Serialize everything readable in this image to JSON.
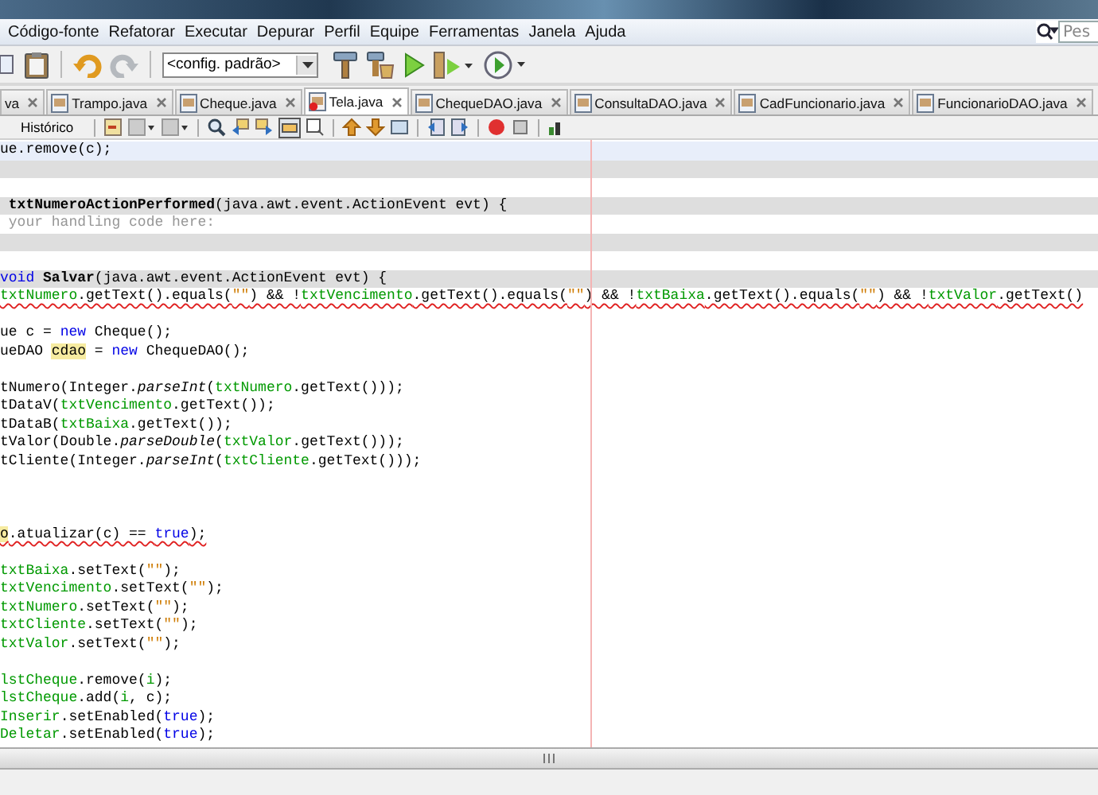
{
  "menu": [
    "Código-fonte",
    "Refatorar",
    "Executar",
    "Depurar",
    "Perfil",
    "Equipe",
    "Ferramentas",
    "Janela",
    "Ajuda"
  ],
  "toolbar": {
    "config": "<config. padrão>"
  },
  "search": {
    "placeholder": "Pes"
  },
  "tabs": [
    {
      "label": "va",
      "selected": false,
      "error": false
    },
    {
      "label": "Trampo.java",
      "selected": false,
      "error": false
    },
    {
      "label": "Cheque.java",
      "selected": false,
      "error": false
    },
    {
      "label": "Tela.java",
      "selected": true,
      "error": true
    },
    {
      "label": "ChequeDAO.java",
      "selected": false,
      "error": false
    },
    {
      "label": "ConsultaDAO.java",
      "selected": false,
      "error": false
    },
    {
      "label": "CadFuncionario.java",
      "selected": false,
      "error": false
    },
    {
      "label": "FuncionarioDAO.java",
      "selected": false,
      "error": false
    }
  ],
  "editor_toolbar": {
    "history": "Histórico"
  },
  "code": {
    "lines": [
      {
        "guarded": false,
        "current": true,
        "error": false,
        "segments": [
          {
            "kind": "plain",
            "text": "ue.remove(c);"
          }
        ]
      },
      {
        "guarded": true,
        "current": false,
        "error": false
      },
      {
        "guarded": false,
        "current": false,
        "error": false
      },
      {
        "guarded": true,
        "current": false,
        "error": false,
        "segments": [
          {
            "kind": "method",
            "text": " txtNumeroActionPerformed"
          },
          {
            "kind": "plain",
            "text": "(java.awt.event.ActionEvent evt) {"
          }
        ]
      },
      {
        "guarded": false,
        "current": false,
        "error": false,
        "segments": [
          {
            "kind": "comment",
            "text": " your handling code here:"
          }
        ]
      },
      {
        "guarded": true,
        "current": false,
        "error": false
      },
      {
        "guarded": false,
        "current": false,
        "error": false
      },
      {
        "guarded": true,
        "current": false,
        "error": false,
        "segments": [
          {
            "kind": "keyword",
            "text": "void "
          },
          {
            "kind": "method",
            "text": "Salvar"
          },
          {
            "kind": "plain",
            "text": "(java.awt.event.ActionEvent evt) {"
          }
        ]
      },
      {
        "guarded": false,
        "current": false,
        "error": true,
        "segments": [
          {
            "kind": "field",
            "text": "txtNumero"
          },
          {
            "kind": "plain",
            "text": ".getText().equals("
          },
          {
            "kind": "string",
            "text": "\"\""
          },
          {
            "kind": "plain",
            "text": ") && !"
          },
          {
            "kind": "field",
            "text": "txtVencimento"
          },
          {
            "kind": "plain",
            "text": ".getText().equals("
          },
          {
            "kind": "string",
            "text": "\"\""
          },
          {
            "kind": "plain",
            "text": ") && !"
          },
          {
            "kind": "field",
            "text": "txtBaixa"
          },
          {
            "kind": "plain",
            "text": ".getText().equals("
          },
          {
            "kind": "string",
            "text": "\"\""
          },
          {
            "kind": "plain",
            "text": ") && !"
          },
          {
            "kind": "field",
            "text": "txtValor"
          },
          {
            "kind": "plain",
            "text": ".getText()"
          }
        ]
      },
      {
        "guarded": false,
        "current": false,
        "error": false
      },
      {
        "guarded": false,
        "current": false,
        "error": false,
        "segments": [
          {
            "kind": "plain",
            "text": "ue c = "
          },
          {
            "kind": "keyword",
            "text": "new"
          },
          {
            "kind": "plain",
            "text": " Cheque();"
          }
        ]
      },
      {
        "guarded": false,
        "current": false,
        "error": false,
        "segments": [
          {
            "kind": "plain",
            "text": "ueDAO "
          },
          {
            "kind": "mark",
            "text": "cdao"
          },
          {
            "kind": "plain",
            "text": " = "
          },
          {
            "kind": "keyword",
            "text": "new"
          },
          {
            "kind": "plain",
            "text": " ChequeDAO();"
          }
        ]
      },
      {
        "guarded": false,
        "current": false,
        "error": false
      },
      {
        "guarded": false,
        "current": false,
        "error": false,
        "segments": [
          {
            "kind": "plain",
            "text": "tNumero(Integer."
          },
          {
            "kind": "italic",
            "text": "parseInt"
          },
          {
            "kind": "plain",
            "text": "("
          },
          {
            "kind": "field",
            "text": "txtNumero"
          },
          {
            "kind": "plain",
            "text": ".getText()));"
          }
        ]
      },
      {
        "guarded": false,
        "current": false,
        "error": false,
        "segments": [
          {
            "kind": "plain",
            "text": "tDataV("
          },
          {
            "kind": "field",
            "text": "txtVencimento"
          },
          {
            "kind": "plain",
            "text": ".getText());"
          }
        ]
      },
      {
        "guarded": false,
        "current": false,
        "error": false,
        "segments": [
          {
            "kind": "plain",
            "text": "tDataB("
          },
          {
            "kind": "field",
            "text": "txtBaixa"
          },
          {
            "kind": "plain",
            "text": ".getText());"
          }
        ]
      },
      {
        "guarded": false,
        "current": false,
        "error": false,
        "segments": [
          {
            "kind": "plain",
            "text": "tValor(Double."
          },
          {
            "kind": "italic",
            "text": "parseDouble"
          },
          {
            "kind": "plain",
            "text": "("
          },
          {
            "kind": "field",
            "text": "txtValor"
          },
          {
            "kind": "plain",
            "text": ".getText()));"
          }
        ]
      },
      {
        "guarded": false,
        "current": false,
        "error": false,
        "segments": [
          {
            "kind": "plain",
            "text": "tCliente(Integer."
          },
          {
            "kind": "italic",
            "text": "parseInt"
          },
          {
            "kind": "plain",
            "text": "("
          },
          {
            "kind": "field",
            "text": "txtCliente"
          },
          {
            "kind": "plain",
            "text": ".getText()));"
          }
        ]
      },
      {
        "guarded": false,
        "current": false,
        "error": false
      },
      {
        "guarded": false,
        "current": false,
        "error": false
      },
      {
        "guarded": false,
        "current": false,
        "error": false
      },
      {
        "guarded": false,
        "current": false,
        "error": true,
        "segments": [
          {
            "kind": "mark",
            "text": "o"
          },
          {
            "kind": "plain",
            "text": ".atualizar(c) == "
          },
          {
            "kind": "keyword",
            "text": "true"
          },
          {
            "kind": "plain",
            "text": ");"
          }
        ]
      },
      {
        "guarded": false,
        "current": false,
        "error": false
      },
      {
        "guarded": false,
        "current": false,
        "error": false,
        "segments": [
          {
            "kind": "field",
            "text": "txtBaixa"
          },
          {
            "kind": "plain",
            "text": ".setText("
          },
          {
            "kind": "string",
            "text": "\"\""
          },
          {
            "kind": "plain",
            "text": ");"
          }
        ]
      },
      {
        "guarded": false,
        "current": false,
        "error": false,
        "segments": [
          {
            "kind": "field",
            "text": "txtVencimento"
          },
          {
            "kind": "plain",
            "text": ".setText("
          },
          {
            "kind": "string",
            "text": "\"\""
          },
          {
            "kind": "plain",
            "text": ");"
          }
        ]
      },
      {
        "guarded": false,
        "current": false,
        "error": false,
        "segments": [
          {
            "kind": "field",
            "text": "txtNumero"
          },
          {
            "kind": "plain",
            "text": ".setText("
          },
          {
            "kind": "string",
            "text": "\"\""
          },
          {
            "kind": "plain",
            "text": ");"
          }
        ]
      },
      {
        "guarded": false,
        "current": false,
        "error": false,
        "segments": [
          {
            "kind": "field",
            "text": "txtCliente"
          },
          {
            "kind": "plain",
            "text": ".setText("
          },
          {
            "kind": "string",
            "text": "\"\""
          },
          {
            "kind": "plain",
            "text": ");"
          }
        ]
      },
      {
        "guarded": false,
        "current": false,
        "error": false,
        "segments": [
          {
            "kind": "field",
            "text": "txtValor"
          },
          {
            "kind": "plain",
            "text": ".setText("
          },
          {
            "kind": "string",
            "text": "\"\""
          },
          {
            "kind": "plain",
            "text": ");"
          }
        ]
      },
      {
        "guarded": false,
        "current": false,
        "error": false
      },
      {
        "guarded": false,
        "current": false,
        "error": false,
        "segments": [
          {
            "kind": "field",
            "text": "lstCheque"
          },
          {
            "kind": "plain",
            "text": ".remove("
          },
          {
            "kind": "field",
            "text": "i"
          },
          {
            "kind": "plain",
            "text": ");"
          }
        ]
      },
      {
        "guarded": false,
        "current": false,
        "error": false,
        "segments": [
          {
            "kind": "field",
            "text": "lstCheque"
          },
          {
            "kind": "plain",
            "text": ".add("
          },
          {
            "kind": "field",
            "text": "i"
          },
          {
            "kind": "plain",
            "text": ", c);"
          }
        ]
      },
      {
        "guarded": false,
        "current": false,
        "error": false,
        "segments": [
          {
            "kind": "field",
            "text": "Inserir"
          },
          {
            "kind": "plain",
            "text": ".setEnabled("
          },
          {
            "kind": "keyword",
            "text": "true"
          },
          {
            "kind": "plain",
            "text": ");"
          }
        ]
      },
      {
        "guarded": false,
        "current": false,
        "error": false,
        "segments": [
          {
            "kind": "field",
            "text": "Deletar"
          },
          {
            "kind": "plain",
            "text": ".setEnabled("
          },
          {
            "kind": "keyword",
            "text": "true"
          },
          {
            "kind": "plain",
            "text": ");"
          }
        ]
      }
    ]
  }
}
